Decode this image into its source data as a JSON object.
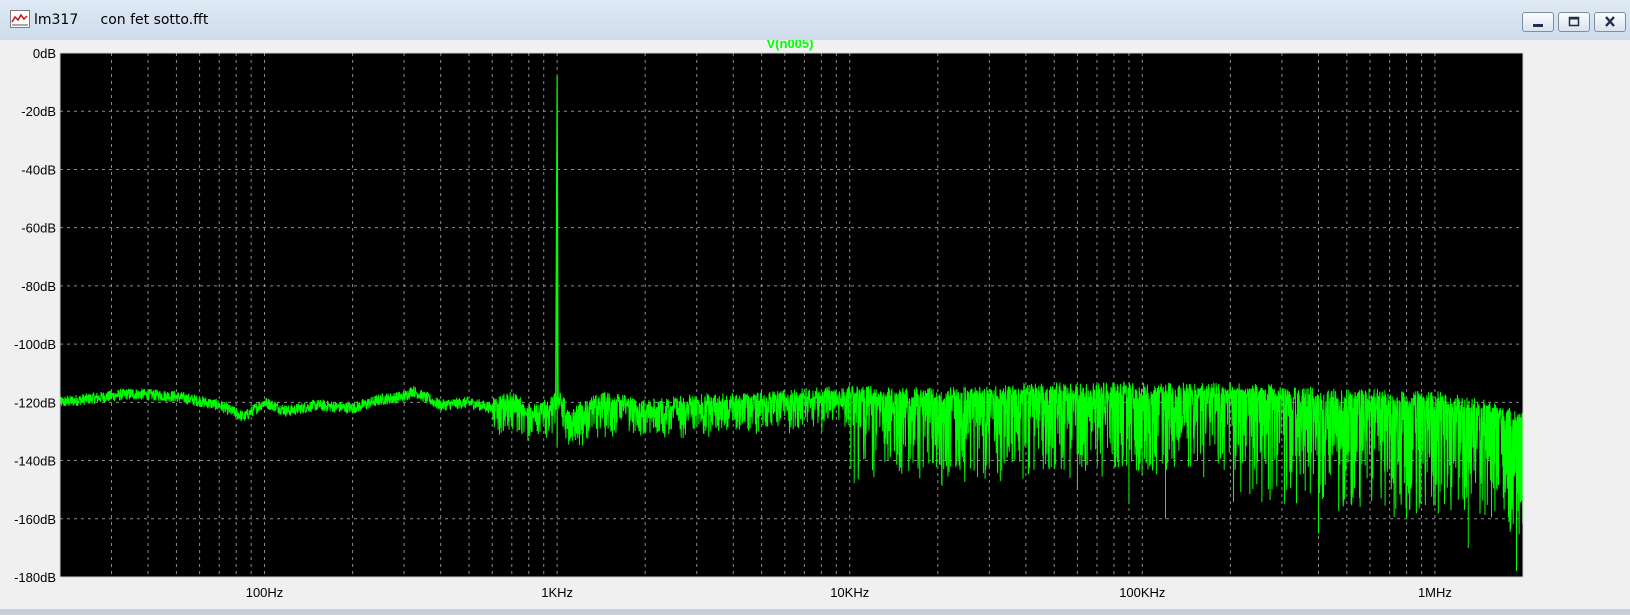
{
  "window": {
    "title": "lm317     con fet sotto.fft",
    "icon": "waveform-icon"
  },
  "colors": {
    "background": "#000000",
    "trace": "#00ff00",
    "grid": "#8a8a8a",
    "margin": "#f0f0f0"
  },
  "chart_data": {
    "type": "line",
    "title": "V(n005)",
    "xscale": "log",
    "xlim": [
      20,
      2000000
    ],
    "ylim": [
      -180,
      0
    ],
    "grid": true,
    "x_ticks": [
      {
        "value": 100,
        "label": "100Hz"
      },
      {
        "value": 1000,
        "label": "1KHz"
      },
      {
        "value": 10000,
        "label": "10KHz"
      },
      {
        "value": 100000,
        "label": "100KHz"
      },
      {
        "value": 1000000,
        "label": "1MHz"
      }
    ],
    "y_ticks": [
      {
        "value": 0,
        "label": "0dB"
      },
      {
        "value": -20,
        "label": "-20dB"
      },
      {
        "value": -40,
        "label": "-40dB"
      },
      {
        "value": -60,
        "label": "-60dB"
      },
      {
        "value": -80,
        "label": "-80dB"
      },
      {
        "value": -100,
        "label": "-100dB"
      },
      {
        "value": -120,
        "label": "-120dB"
      },
      {
        "value": -140,
        "label": "-140dB"
      },
      {
        "value": -160,
        "label": "-160dB"
      },
      {
        "value": -180,
        "label": "-180dB"
      }
    ],
    "series": [
      {
        "name": "V(n005)",
        "x": [
          20,
          35,
          50,
          70,
          85,
          100,
          120,
          150,
          200,
          250,
          300,
          320,
          400,
          500,
          600,
          700,
          800,
          900,
          980,
          1000,
          1020,
          1100,
          1300,
          1500,
          2000,
          3000,
          5000,
          10000,
          20000,
          30000,
          50000,
          100000,
          200000,
          300000,
          500000,
          1000000,
          1500000,
          2000000
        ],
        "y": [
          -120,
          -117,
          -118,
          -121,
          -125,
          -120,
          -123,
          -121,
          -122,
          -119,
          -118,
          -116,
          -121,
          -120,
          -122,
          -120,
          -124,
          -123,
          -120,
          -8,
          -120,
          -125,
          -122,
          -120,
          -123,
          -121,
          -120,
          -118,
          -119,
          -118,
          -117,
          -117,
          -117,
          -118,
          -119,
          -120,
          -123,
          -127
        ],
        "floor_dips_db": [
          -135,
          -140,
          -150,
          -155,
          -160,
          -165,
          -160,
          -170,
          -178
        ]
      }
    ]
  }
}
